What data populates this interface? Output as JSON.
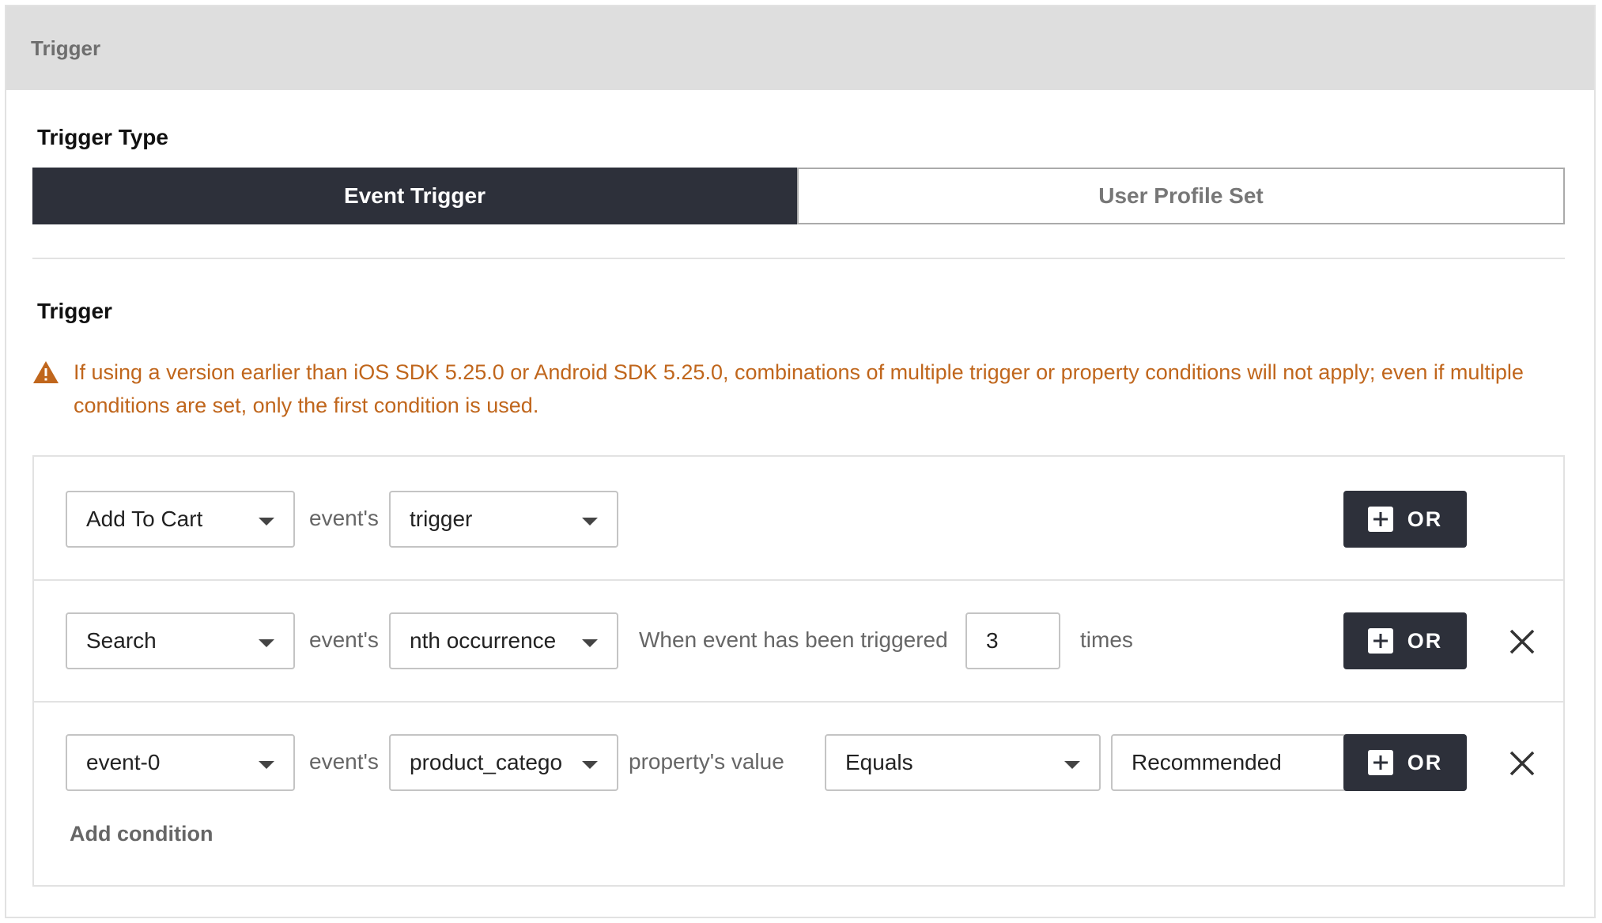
{
  "panel": {
    "title": "Trigger"
  },
  "trigger_type": {
    "label": "Trigger Type",
    "tabs": [
      {
        "label": "Event Trigger",
        "active": true
      },
      {
        "label": "User Profile Set",
        "active": false
      }
    ]
  },
  "trigger": {
    "label": "Trigger",
    "warning": "If using a version earlier than iOS SDK 5.25.0 or Android SDK 5.25.0, combinations of multiple trigger or property conditions will not apply; even if multiple conditions are set, only the first condition is used.",
    "rows": [
      {
        "event": "Add To Cart",
        "connector": "event's",
        "property": "trigger",
        "or_label": "OR"
      },
      {
        "event": "Search",
        "connector": "event's",
        "property": "nth occurrence",
        "prefix_text": "When event has been triggered",
        "count": "3",
        "suffix_text": "times",
        "or_label": "OR"
      },
      {
        "event": "event-0",
        "connector": "event's",
        "property": "product_category",
        "property_value_label": "property's value",
        "operator": "Equals",
        "value": "Recommended",
        "or_label": "OR"
      }
    ],
    "add_condition": "Add condition"
  },
  "colors": {
    "dark": "#2d303a",
    "warning": "#c0661c",
    "header_bg": "#dedede"
  },
  "icons": {
    "warning": "warning-triangle-icon",
    "caret": "caret-down-icon",
    "plus": "plus-icon",
    "close": "close-icon"
  }
}
